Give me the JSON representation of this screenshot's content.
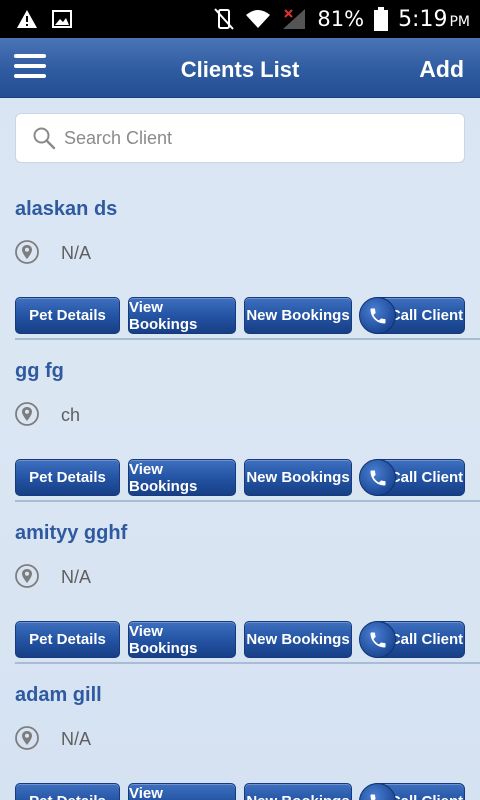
{
  "status_bar": {
    "battery": "81%",
    "time": "5:19",
    "ampm": "PM"
  },
  "header": {
    "title": "Clients List",
    "add_label": "Add"
  },
  "search": {
    "placeholder": "Search Client",
    "value": ""
  },
  "buttons": {
    "pet_details": "Pet Details",
    "view_bookings": "View Bookings",
    "new_bookings": "New Bookings",
    "call_client": "Call Client"
  },
  "clients": [
    {
      "name": "alaskan ds",
      "address": "N/A"
    },
    {
      "name": "gg fg",
      "address": "ch"
    },
    {
      "name": "amityy gghf",
      "address": "N/A"
    },
    {
      "name": "adam gill",
      "address": "N/A"
    }
  ],
  "colors": {
    "header_bg": "#2f5ba1",
    "accent_text": "#2f5aa0",
    "button_bg": "#2454a4"
  }
}
